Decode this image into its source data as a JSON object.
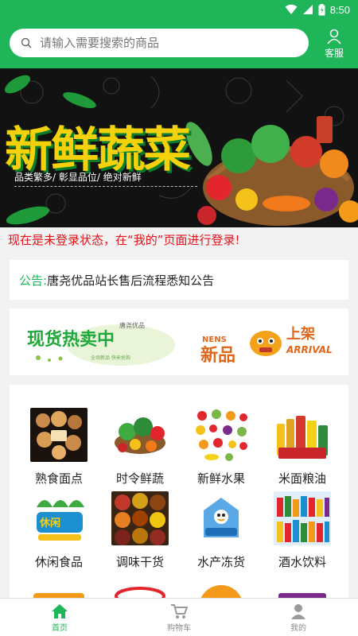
{
  "status_bar": {
    "time": "8:50"
  },
  "header": {
    "search_placeholder": "请输入需要搜索的商品",
    "service_label": "客服"
  },
  "banner": {
    "title": "新鲜蔬菜",
    "subtitle": "品类繁多/ 彰显品位/ 绝对新鲜"
  },
  "login_notice": "现在是未登录状态，在“我的”页面进行登录!",
  "announcement": {
    "label": "公告:",
    "text": "唐尧优品站长售后流程悉知公告"
  },
  "promo": {
    "left_main": "现货热卖中",
    "left_small": "唐尧优品",
    "left_caption": "全场新品 快来抢购",
    "right_en": "NENS",
    "right_main": "新品",
    "right_cn": "上架",
    "right_en2": "ARRIVAL"
  },
  "categories": [
    {
      "label": "熟食面点",
      "icon": "pastry-icon"
    },
    {
      "label": "时令鲜蔬",
      "icon": "vegetable-icon"
    },
    {
      "label": "新鲜水果",
      "icon": "fruit-icon"
    },
    {
      "label": "米面粮油",
      "icon": "grain-oil-icon"
    },
    {
      "label": "休闲食品",
      "icon": "snack-icon"
    },
    {
      "label": "调味干货",
      "icon": "spice-icon"
    },
    {
      "label": "水产冻货",
      "icon": "frozen-seafood-icon"
    },
    {
      "label": "酒水饮料",
      "icon": "beverage-icon"
    }
  ],
  "tabbar": {
    "tabs": [
      {
        "label": "首页",
        "active": true
      },
      {
        "label": "购物车",
        "active": false
      },
      {
        "label": "我的",
        "active": false
      }
    ]
  },
  "colors": {
    "brand_green": "#1fb65a",
    "notice_red": "#e5121a",
    "banner_yellow": "#f5d10c"
  }
}
